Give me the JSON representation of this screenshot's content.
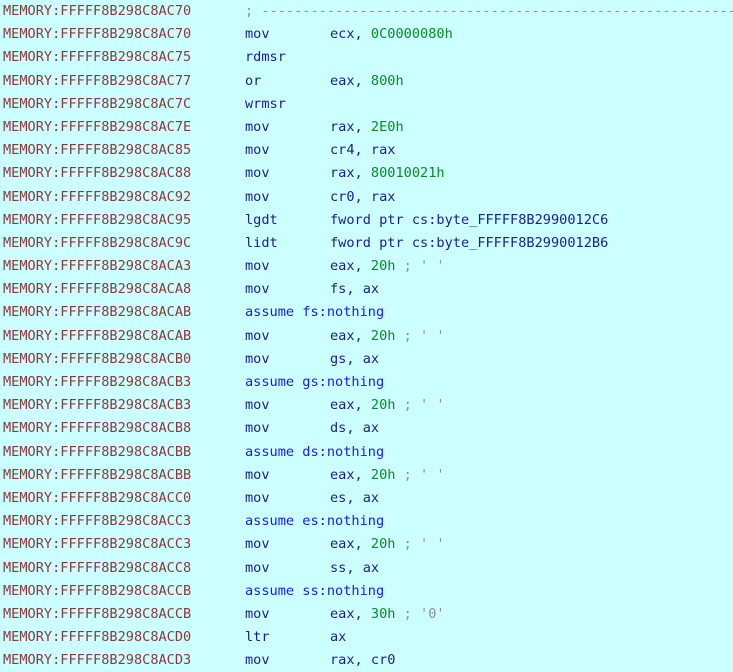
{
  "view": {
    "name": "ida-disassembly",
    "background_color": "#ccffff",
    "address_color": "#8a3a3a",
    "mnemonic_color": "#1d1d8f",
    "operand_color": "#1d1d8f",
    "immediate_color": "#0a8a23",
    "directive_color": "#1a1aee",
    "comment_color": "#8f8f8f",
    "segment": "MEMORY"
  },
  "lines": [
    {
      "kind": "comment",
      "address": "MEMORY:FFFFF8B298C8AC70",
      "text": "; ---------------------------------------------------------------------------"
    },
    {
      "kind": "instruction",
      "address": "MEMORY:FFFFF8B298C8AC70",
      "mnemonic": "mov",
      "operand_pre": "ecx, ",
      "immediate": "0C0000080h",
      "operand_post": "",
      "comment": ""
    },
    {
      "kind": "instruction",
      "address": "MEMORY:FFFFF8B298C8AC75",
      "mnemonic": "rdmsr",
      "operand_pre": "",
      "immediate": "",
      "operand_post": "",
      "comment": ""
    },
    {
      "kind": "instruction",
      "address": "MEMORY:FFFFF8B298C8AC77",
      "mnemonic": "or",
      "operand_pre": "eax, ",
      "immediate": "800h",
      "operand_post": "",
      "comment": ""
    },
    {
      "kind": "instruction",
      "address": "MEMORY:FFFFF8B298C8AC7C",
      "mnemonic": "wrmsr",
      "operand_pre": "",
      "immediate": "",
      "operand_post": "",
      "comment": ""
    },
    {
      "kind": "instruction",
      "address": "MEMORY:FFFFF8B298C8AC7E",
      "mnemonic": "mov",
      "operand_pre": "rax, ",
      "immediate": "2E0h",
      "operand_post": "",
      "comment": ""
    },
    {
      "kind": "instruction",
      "address": "MEMORY:FFFFF8B298C8AC85",
      "mnemonic": "mov",
      "operand_pre": "cr4, rax",
      "immediate": "",
      "operand_post": "",
      "comment": ""
    },
    {
      "kind": "instruction",
      "address": "MEMORY:FFFFF8B298C8AC88",
      "mnemonic": "mov",
      "operand_pre": "rax, ",
      "immediate": "80010021h",
      "operand_post": "",
      "comment": ""
    },
    {
      "kind": "instruction",
      "address": "MEMORY:FFFFF8B298C8AC92",
      "mnemonic": "mov",
      "operand_pre": "cr0, rax",
      "immediate": "",
      "operand_post": "",
      "comment": ""
    },
    {
      "kind": "instruction",
      "address": "MEMORY:FFFFF8B298C8AC95",
      "mnemonic": "lgdt",
      "operand_pre": "fword ptr cs:byte_FFFFF8B2990012C6",
      "immediate": "",
      "operand_post": "",
      "comment": ""
    },
    {
      "kind": "instruction",
      "address": "MEMORY:FFFFF8B298C8AC9C",
      "mnemonic": "lidt",
      "operand_pre": "fword ptr cs:byte_FFFFF8B2990012B6",
      "immediate": "",
      "operand_post": "",
      "comment": ""
    },
    {
      "kind": "instruction",
      "address": "MEMORY:FFFFF8B298C8ACA3",
      "mnemonic": "mov",
      "operand_pre": "eax, ",
      "immediate": "20h",
      "operand_post": "",
      "comment": " ; ' '"
    },
    {
      "kind": "instruction",
      "address": "MEMORY:FFFFF8B298C8ACA8",
      "mnemonic": "mov",
      "operand_pre": "fs, ax",
      "immediate": "",
      "operand_post": "",
      "comment": ""
    },
    {
      "kind": "directive",
      "address": "MEMORY:FFFFF8B298C8ACAB",
      "text": "assume fs:nothing"
    },
    {
      "kind": "instruction",
      "address": "MEMORY:FFFFF8B298C8ACAB",
      "mnemonic": "mov",
      "operand_pre": "eax, ",
      "immediate": "20h",
      "operand_post": "",
      "comment": " ; ' '"
    },
    {
      "kind": "instruction",
      "address": "MEMORY:FFFFF8B298C8ACB0",
      "mnemonic": "mov",
      "operand_pre": "gs, ax",
      "immediate": "",
      "operand_post": "",
      "comment": ""
    },
    {
      "kind": "directive",
      "address": "MEMORY:FFFFF8B298C8ACB3",
      "text": "assume gs:nothing"
    },
    {
      "kind": "instruction",
      "address": "MEMORY:FFFFF8B298C8ACB3",
      "mnemonic": "mov",
      "operand_pre": "eax, ",
      "immediate": "20h",
      "operand_post": "",
      "comment": " ; ' '"
    },
    {
      "kind": "instruction",
      "address": "MEMORY:FFFFF8B298C8ACB8",
      "mnemonic": "mov",
      "operand_pre": "ds, ax",
      "immediate": "",
      "operand_post": "",
      "comment": ""
    },
    {
      "kind": "directive",
      "address": "MEMORY:FFFFF8B298C8ACBB",
      "text": "assume ds:nothing"
    },
    {
      "kind": "instruction",
      "address": "MEMORY:FFFFF8B298C8ACBB",
      "mnemonic": "mov",
      "operand_pre": "eax, ",
      "immediate": "20h",
      "operand_post": "",
      "comment": " ; ' '"
    },
    {
      "kind": "instruction",
      "address": "MEMORY:FFFFF8B298C8ACC0",
      "mnemonic": "mov",
      "operand_pre": "es, ax",
      "immediate": "",
      "operand_post": "",
      "comment": ""
    },
    {
      "kind": "directive",
      "address": "MEMORY:FFFFF8B298C8ACC3",
      "text": "assume es:nothing"
    },
    {
      "kind": "instruction",
      "address": "MEMORY:FFFFF8B298C8ACC3",
      "mnemonic": "mov",
      "operand_pre": "eax, ",
      "immediate": "20h",
      "operand_post": "",
      "comment": " ; ' '"
    },
    {
      "kind": "instruction",
      "address": "MEMORY:FFFFF8B298C8ACC8",
      "mnemonic": "mov",
      "operand_pre": "ss, ax",
      "immediate": "",
      "operand_post": "",
      "comment": ""
    },
    {
      "kind": "directive",
      "address": "MEMORY:FFFFF8B298C8ACCB",
      "text": "assume ss:nothing"
    },
    {
      "kind": "instruction",
      "address": "MEMORY:FFFFF8B298C8ACCB",
      "mnemonic": "mov",
      "operand_pre": "eax, ",
      "immediate": "30h",
      "operand_post": "",
      "comment": " ; '0'"
    },
    {
      "kind": "instruction",
      "address": "MEMORY:FFFFF8B298C8ACD0",
      "mnemonic": "ltr",
      "operand_pre": "ax",
      "immediate": "",
      "operand_post": "",
      "comment": ""
    },
    {
      "kind": "instruction",
      "address": "MEMORY:FFFFF8B298C8ACD3",
      "mnemonic": "mov",
      "operand_pre": "rax, cr0",
      "immediate": "",
      "operand_post": "",
      "comment": ""
    }
  ]
}
